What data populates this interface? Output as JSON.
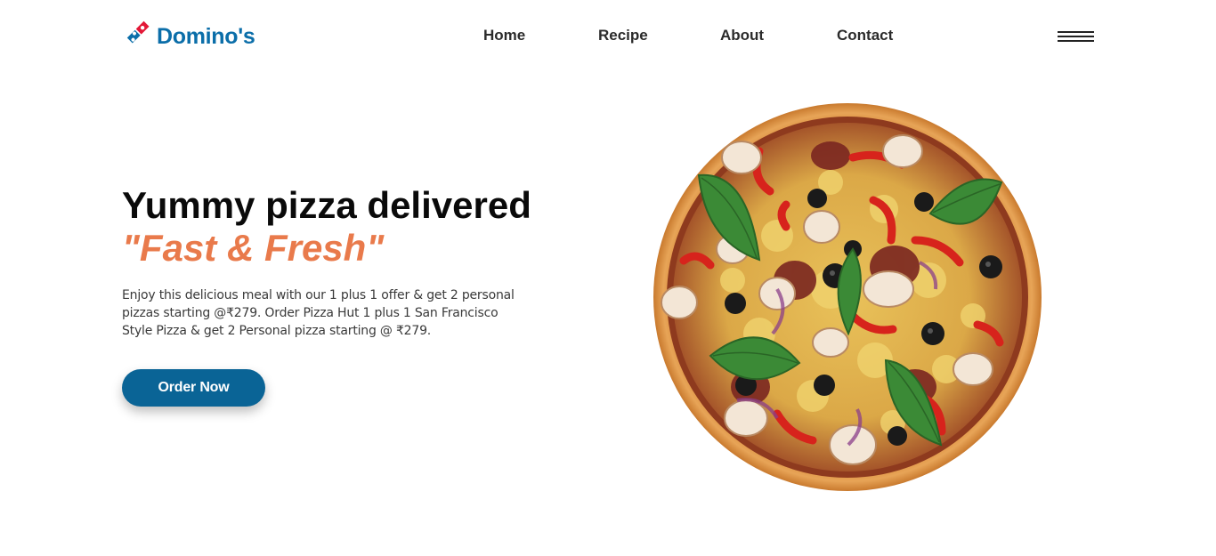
{
  "header": {
    "logo_text": "Domino's",
    "logo_trademark": "",
    "nav": [
      {
        "label": "Home"
      },
      {
        "label": "Recipe"
      },
      {
        "label": "About"
      },
      {
        "label": "Contact"
      }
    ],
    "menu_icon": "hamburger-menu-icon"
  },
  "hero": {
    "title": "Yummy pizza delivered",
    "tagline": "\"Fast & Fresh\"",
    "description": "Enjoy this delicious meal with our 1 plus 1 offer & get 2 personal pizzas starting @₹279. Order Pizza Hut 1 plus 1 San Francisco Style Pizza & get 2 Personal pizza starting @ ₹279.",
    "cta_label": "Order Now",
    "image": "pizza-image"
  },
  "colors": {
    "brand_blue": "#0b6ea9",
    "brand_red": "#e31837",
    "accent_orange": "#e97a4b",
    "button_blue": "#0a6496"
  }
}
